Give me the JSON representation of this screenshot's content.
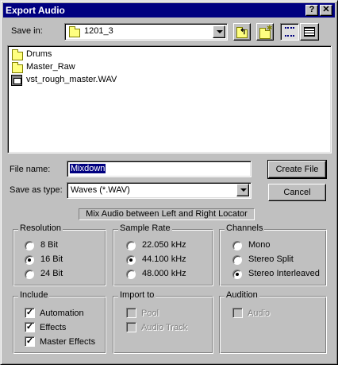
{
  "title": "Export Audio",
  "title_buttons": {
    "help": "?",
    "close": "✕"
  },
  "save_in": {
    "label": "Save in:",
    "value": "1201_3"
  },
  "toolbar_icons": [
    "up-folder-icon",
    "new-folder-icon",
    "list-view-icon",
    "details-view-icon"
  ],
  "files": [
    {
      "name": "Drums",
      "type": "folder"
    },
    {
      "name": "Master_Raw",
      "type": "folder"
    },
    {
      "name": "vst_rough_master.WAV",
      "type": "wav"
    }
  ],
  "file_name": {
    "label": "File name:",
    "value": "Mixdown"
  },
  "save_as_type": {
    "label": "Save as type:",
    "value": "Waves (*.WAV)"
  },
  "buttons": {
    "create": "Create File",
    "cancel": "Cancel"
  },
  "mix_note": "Mix Audio between Left and Right Locator",
  "resolution": {
    "title": "Resolution",
    "options": [
      "8 Bit",
      "16 Bit",
      "24 Bit"
    ],
    "selected": "16 Bit"
  },
  "sample_rate": {
    "title": "Sample Rate",
    "options": [
      "22.050 kHz",
      "44.100 kHz",
      "48.000 kHz"
    ],
    "selected": "44.100 kHz"
  },
  "channels": {
    "title": "Channels",
    "options": [
      "Mono",
      "Stereo Split",
      "Stereo Interleaved"
    ],
    "selected": "Stereo Interleaved"
  },
  "include": {
    "title": "Include",
    "items": [
      {
        "label": "Automation",
        "checked": true
      },
      {
        "label": "Effects",
        "checked": true
      },
      {
        "label": "Master Effects",
        "checked": true
      }
    ]
  },
  "import_to": {
    "title": "Import to",
    "items": [
      {
        "label": "Pool",
        "checked": false,
        "enabled": false
      },
      {
        "label": "Audio Track",
        "checked": false,
        "enabled": false
      }
    ]
  },
  "audition": {
    "title": "Audition",
    "items": [
      {
        "label": "Audio",
        "checked": false,
        "enabled": false
      }
    ]
  },
  "colors": {
    "title_bar": "#000080",
    "face": "#c0c0c0",
    "selection": "#000080"
  }
}
